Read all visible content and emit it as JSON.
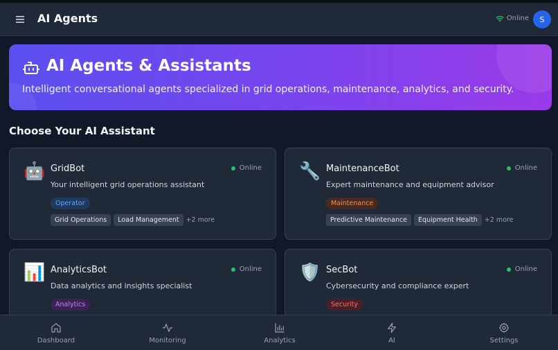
{
  "header": {
    "title": "AI Agents",
    "status": "Online",
    "avatar_initial": "S"
  },
  "hero": {
    "title": "AI Agents & Assistants",
    "subtitle": "Intelligent conversational agents specialized in grid operations, maintenance, analytics, and security."
  },
  "section_title": "Choose Your AI Assistant",
  "agents": [
    {
      "icon": "robot-icon",
      "emoji": "🤖",
      "name": "GridBot",
      "status": "Online",
      "description": "Your intelligent grid operations assistant",
      "role": "Operator",
      "tags": [
        "Grid Operations",
        "Load Management"
      ],
      "more": "+2 more"
    },
    {
      "icon": "wrench-icon",
      "emoji": "🔧",
      "name": "MaintenanceBot",
      "status": "Online",
      "description": "Expert maintenance and equipment advisor",
      "role": "Maintenance",
      "tags": [
        "Predictive Maintenance",
        "Equipment Health"
      ],
      "more": "+2 more"
    },
    {
      "icon": "bar-chart-icon",
      "emoji": "📊",
      "name": "AnalyticsBot",
      "status": "Online",
      "description": "Data analytics and insights specialist",
      "role": "Analytics",
      "tags": [],
      "more": ""
    },
    {
      "icon": "shield-icon",
      "emoji": "🛡️",
      "name": "SecBot",
      "status": "Online",
      "description": "Cybersecurity and compliance expert",
      "role": "Security",
      "tags": [],
      "more": ""
    }
  ],
  "nav": [
    {
      "label": "Dashboard",
      "icon": "home-icon"
    },
    {
      "label": "Monitoring",
      "icon": "activity-icon"
    },
    {
      "label": "Analytics",
      "icon": "bar-chart-icon"
    },
    {
      "label": "AI",
      "icon": "lightning-icon"
    },
    {
      "label": "Settings",
      "icon": "gear-icon"
    }
  ],
  "colors": {
    "background": "#111827",
    "surface": "#1f2937",
    "accent": "#2563eb",
    "online": "#22c55e",
    "hero_start": "#5b4ff0",
    "hero_end": "#9a3ae8"
  }
}
